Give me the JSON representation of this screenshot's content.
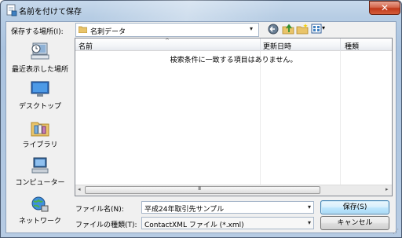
{
  "window": {
    "title": "名前を付けて保存",
    "close_label": "✕"
  },
  "toolbar": {
    "lookin_label": "保存する場所(I):",
    "lookin_value": "名刺データ",
    "lookin_arrow": "▾",
    "view_arrow": "▾"
  },
  "places": [
    {
      "label": "最近表示した場所"
    },
    {
      "label": "デスクトップ"
    },
    {
      "label": "ライブラリ"
    },
    {
      "label": "コンピューター"
    },
    {
      "label": "ネットワーク"
    }
  ],
  "filelist": {
    "columns": [
      "名前",
      "更新日時",
      "種類"
    ],
    "sort_indicator": "^",
    "empty_message": "検索条件に一致する項目はありません。",
    "scroll_left": "◂",
    "scroll_right": "▸",
    "scroll_grip": "III"
  },
  "form": {
    "filename_label": "ファイル名(N):",
    "filename_value": "平成24年取引先サンプル",
    "filetype_label": "ファイルの種類(T):",
    "filetype_value": "ContactXML ファイル (*.xml)",
    "dropdown_arrow": "▾"
  },
  "buttons": {
    "save": "保存(S)",
    "cancel": "キャンセル"
  },
  "colors": {
    "frame": "#aac3df",
    "default_button": "#bee6fd",
    "close_button": "#c0391b"
  }
}
